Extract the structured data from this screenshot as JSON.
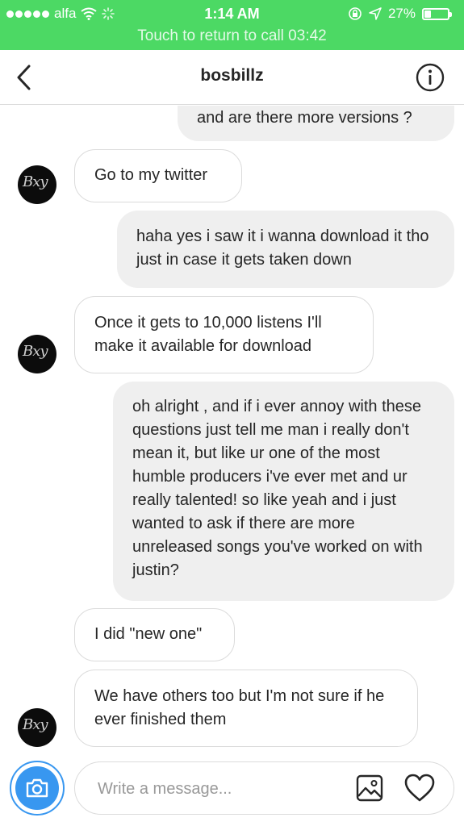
{
  "status_bar": {
    "carrier": "alfa",
    "time": "1:14 AM",
    "battery_percent": "27%",
    "battery_level": 0.27,
    "call_banner": "Touch to return to call 03:42"
  },
  "header": {
    "username": "bosbillz"
  },
  "messages": [
    {
      "side": "out",
      "text": "and are there more versions ?"
    },
    {
      "side": "in",
      "text": "Go to my twitter"
    },
    {
      "side": "out",
      "text": "haha yes i saw it i wanna download it tho just in case it gets taken down"
    },
    {
      "side": "in",
      "text": "Once it gets to 10,000 listens I'll make it available for download"
    },
    {
      "side": "out",
      "text": "oh alright , and if i ever annoy with these questions just tell me man i really don't mean it, but like ur one of the most humble producers i've ever met and ur really talented! so like yeah and i just wanted to ask if  there are more unreleased songs you've worked on with justin?"
    },
    {
      "side": "in",
      "text": "I did \"new one\""
    },
    {
      "side": "in",
      "text": "We have others too but I'm not sure if he ever finished them"
    }
  ],
  "composer": {
    "placeholder": "Write a message..."
  },
  "colors": {
    "status_green": "#4cd964",
    "accent_blue": "#3897f0",
    "bubble_out": "#efefef",
    "bubble_border": "#dbdbdb"
  },
  "icons": {
    "back": "chevron-left-icon",
    "info": "info-icon",
    "camera": "camera-icon",
    "gallery": "gallery-icon",
    "like": "heart-icon"
  }
}
